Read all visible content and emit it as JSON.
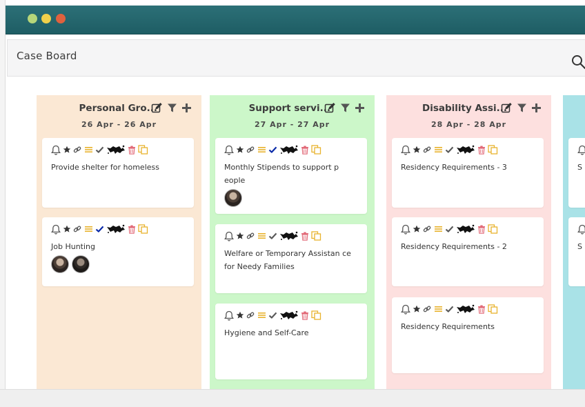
{
  "window": {
    "controls": [
      "minimize",
      "maximize",
      "close"
    ],
    "colors": {
      "titlebar": "#236870",
      "minimize": "#b6d67a",
      "maximize": "#f1d04b",
      "close": "#e0613e"
    }
  },
  "header": {
    "title": "Case Board",
    "search_icon": "search-icon"
  },
  "columns": [
    {
      "title": "Personal Gro...",
      "date_range": "26 Apr - 26 Apr",
      "color": "#fbe8d4",
      "cards": [
        {
          "text": "Provide shelter for homeless",
          "check_color": "#5a5a5a",
          "avatars": 0
        },
        {
          "text": "Job Hunting",
          "check_color": "#0a2aa8",
          "avatars": 2
        }
      ]
    },
    {
      "title": "Support servi...",
      "date_range": "27 Apr - 27 Apr",
      "color": "#ccf7c9",
      "cards": [
        {
          "text": "Monthly Stipends to support p eople",
          "check_color": "#0a2aa8",
          "avatars": 1
        },
        {
          "text": "Welfare or Temporary Assistan ce for Needy Families",
          "check_color": "#5a5a5a",
          "avatars": 0
        },
        {
          "text": "Hygiene and Self-Care",
          "check_color": "#5a5a5a",
          "avatars": 0
        }
      ]
    },
    {
      "title": "Disability Assi...",
      "date_range": "28 Apr - 28 Apr",
      "color": "#fde0df",
      "cards": [
        {
          "text": "Residency Requirements - 3",
          "check_color": "#5a5a5a",
          "avatars": 0
        },
        {
          "text": "Residency Requirements - 2",
          "check_color": "#5a5a5a",
          "avatars": 0
        },
        {
          "text": "Residency Requirements",
          "check_color": "#5a5a5a",
          "avatars": 0
        }
      ]
    },
    {
      "title": "",
      "date_range": "",
      "color": "#a9e2e7",
      "cards": [
        {
          "text": "S s",
          "check_color": "#5a5a5a",
          "avatars": 0
        },
        {
          "text": "S s",
          "check_color": "#5a5a5a",
          "avatars": 0
        }
      ]
    }
  ],
  "card_icons": [
    "bell-icon",
    "star-icon",
    "link-icon",
    "list-icon",
    "check-icon",
    "ink-blot-icon",
    "trash-icon",
    "copy-icon"
  ],
  "column_actions": [
    "edit-icon",
    "filter-icon",
    "plus-icon"
  ],
  "icon_colors": {
    "list": "#e8b22c",
    "trash": "#e26a78",
    "copy": "#e8b22c",
    "gray": "#555555"
  }
}
